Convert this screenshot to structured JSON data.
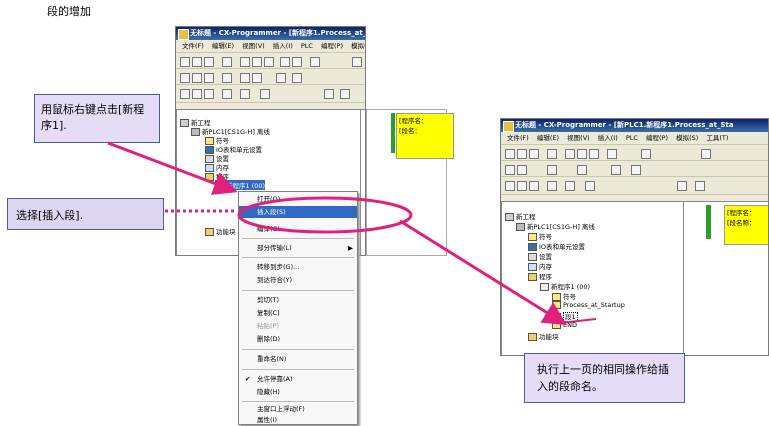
{
  "heading": "段的增加",
  "app_title": "无标题 - CX-Programmer - [新程序1.Process_at_S",
  "app_title_right": "无标题 - CX-Programmer - [新PLC1.新程序1.Process_at_Sta",
  "menu": [
    "文件(F)",
    "编辑(E)",
    "视图(V)",
    "插入(I)",
    "PLC",
    "编程(P)",
    "模拟(S)",
    "工具(T)"
  ],
  "left_tree": {
    "root": "新工程",
    "plc": "新PLC1[CS1G-H] 离线",
    "items": [
      "符号",
      "IO表和单元设置",
      "设置",
      "内存",
      "程序",
      "新程序1 (00)",
      "功能块"
    ]
  },
  "context_menu": {
    "items": [
      "打开(O)",
      "插入段(S)",
      "编译(C)",
      "部分传输(L)",
      "转移到步(G)...",
      "到达符合(Y)",
      "剪切(T)",
      "复制(C)",
      "粘贴(P)",
      "删除(D)",
      "重命名(N)",
      "允许停靠(A)",
      "隐藏(H)",
      "主窗口上浮动(F)",
      "属性(I)"
    ],
    "highlighted": "插入段(S)"
  },
  "right_tree": {
    "root": "新工程",
    "plc": "新PLC1[CS1G-H] 离线",
    "items": [
      "符号",
      "IO表和单元设置",
      "设置",
      "内存",
      "程序",
      "新程序1 (00)",
      "符号",
      "Process_at_Startup",
      "段1",
      "END",
      "功能块"
    ]
  },
  "editor": {
    "left_lines": [
      "[程序名：",
      "[段名："
    ],
    "right_lines": [
      "[程序名：",
      "[段名称："
    ]
  },
  "callouts": {
    "right_click": "用鼠标右键点击[新程序1].",
    "select_insert": "选择[插入段].",
    "rename": "执行上一页的相同操作给插入的段命名。"
  },
  "colors": {
    "callout_fill": "#e5dcf7",
    "arrow": "#e0207a",
    "highlight": "#316ac5",
    "ladder_rail": "#2aa02a",
    "ladder_box": "#ffff00"
  }
}
